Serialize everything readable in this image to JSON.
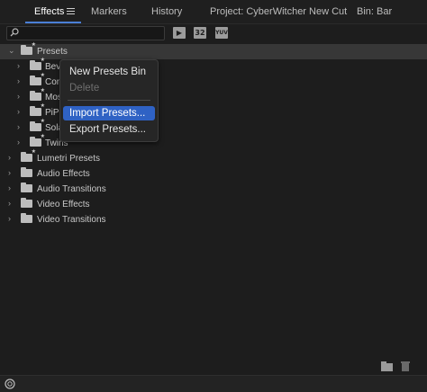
{
  "tabs": [
    {
      "label": "Effects"
    },
    {
      "label": "Markers"
    },
    {
      "label": "History"
    },
    {
      "label": "Project: CyberWitcher New Cut"
    },
    {
      "label": "Bin: Bar"
    }
  ],
  "search": {
    "value": "",
    "placeholder": ""
  },
  "toolbar": {
    "accelerated_icon": "accelerated-effects-icon",
    "badge_32": "32",
    "badge_yuv": "YUV"
  },
  "tree": {
    "root": {
      "label": "Presets"
    },
    "preset_children": [
      {
        "label": "Bev"
      },
      {
        "label": "Con"
      },
      {
        "label": "Mos"
      },
      {
        "label": "PiP"
      },
      {
        "label": "Sola"
      },
      {
        "label": "Twirls"
      }
    ],
    "top_level": [
      {
        "label": "Lumetri Presets"
      },
      {
        "label": "Audio Effects"
      },
      {
        "label": "Audio Transitions"
      },
      {
        "label": "Video Effects"
      },
      {
        "label": "Video Transitions"
      }
    ]
  },
  "context_menu": {
    "items": [
      {
        "label": "New Presets Bin"
      },
      {
        "label": "Delete"
      },
      {
        "label": "Import Presets..."
      },
      {
        "label": "Export Presets..."
      }
    ]
  },
  "colors": {
    "accent": "#2f62c4",
    "tab_underline": "#4a7fd6",
    "background": "#1d1d1d"
  }
}
